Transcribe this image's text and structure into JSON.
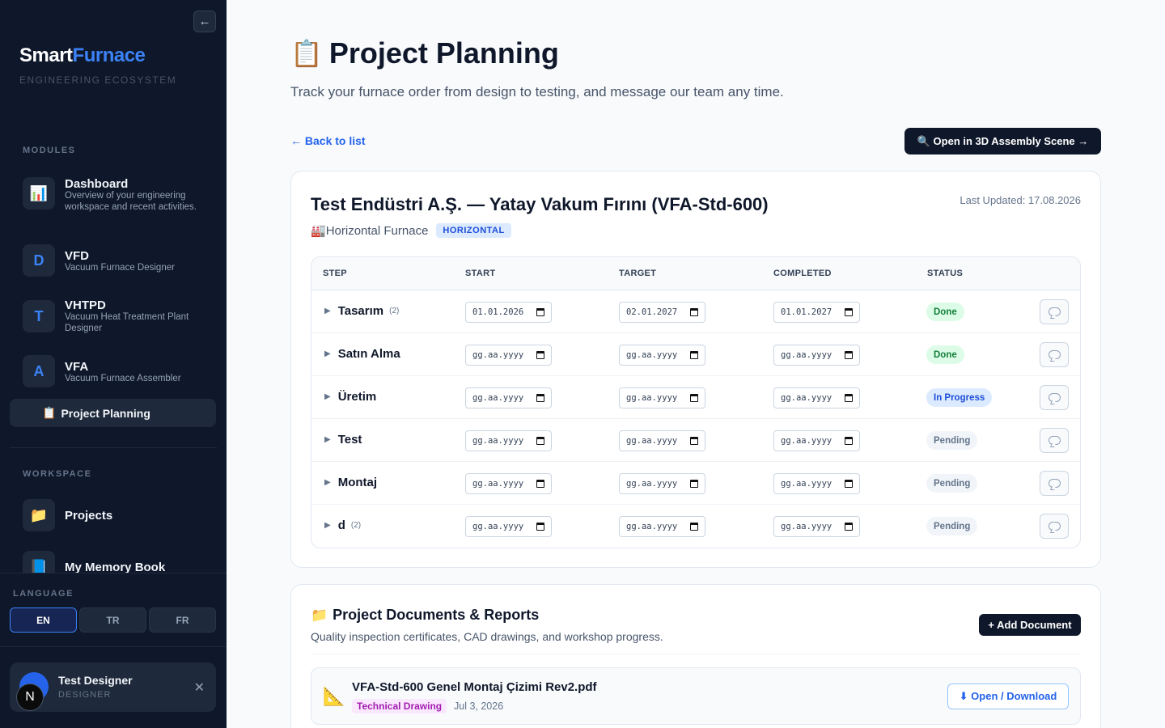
{
  "sidebar": {
    "collapse_icon": "←",
    "brand_part1": "Smart",
    "brand_part2": "Furnace",
    "brand_sub": "ENGINEERING ECOSYSTEM",
    "modules_label": "MODULES",
    "modules": [
      {
        "icon": "📊",
        "title": "Dashboard",
        "desc": "Overview of your engineering workspace and recent activities."
      },
      {
        "icon": "D",
        "title": "VFD",
        "desc": "Vacuum Furnace Designer"
      },
      {
        "icon": "T",
        "title": "VHTPD",
        "desc": "Vacuum Heat Treatment Plant Designer"
      },
      {
        "icon": "A",
        "title": "VFA",
        "desc": "Vacuum Furnace Assembler"
      }
    ],
    "active_item": {
      "icon": "📋",
      "label": "Project Planning"
    },
    "workspace_label": "WORKSPACE",
    "workspace": [
      {
        "icon": "📁",
        "label": "Projects"
      },
      {
        "icon": "📘",
        "label": "My Memory Book"
      }
    ],
    "language_label": "LANGUAGE",
    "languages": [
      "EN",
      "TR",
      "FR"
    ],
    "active_language": "EN",
    "user": {
      "initial": "N",
      "name": "Test Designer",
      "role": "DESIGNER",
      "close": "✕"
    }
  },
  "header": {
    "icon": "📋",
    "title": "Project Planning",
    "subtitle": "Track your furnace order from design to testing, and message our team any time."
  },
  "toolbar": {
    "back_label": "← Back to list",
    "open3d_label": "🔍 Open in 3D Assembly Scene →"
  },
  "project": {
    "title": "Test Endüstri A.Ş. — Yatay Vakum Fırını (VFA-Std-600)",
    "last_updated": "Last Updated: 17.08.2026",
    "type_icon": "🏭",
    "type_label": "Horizontal Furnace",
    "type_badge": "HORIZONTAL"
  },
  "table": {
    "columns": [
      "STEP",
      "START",
      "TARGET",
      "COMPLETED",
      "STATUS"
    ],
    "rows": [
      {
        "step": "Tasarım",
        "count": "(2)",
        "start": "01.01.2026",
        "target": "02.01.2027",
        "completed": "01.01.2027",
        "status": "Done",
        "status_kind": "done"
      },
      {
        "step": "Satın Alma",
        "count": "",
        "start": "gg.aa.yyyy",
        "target": "gg.aa.yyyy",
        "completed": "gg.aa.yyyy",
        "status": "Done",
        "status_kind": "done"
      },
      {
        "step": "Üretim",
        "count": "",
        "start": "gg.aa.yyyy",
        "target": "gg.aa.yyyy",
        "completed": "gg.aa.yyyy",
        "status": "In Progress",
        "status_kind": "prog"
      },
      {
        "step": "Test",
        "count": "",
        "start": "gg.aa.yyyy",
        "target": "gg.aa.yyyy",
        "completed": "gg.aa.yyyy",
        "status": "Pending",
        "status_kind": "pend"
      },
      {
        "step": "Montaj",
        "count": "",
        "start": "gg.aa.yyyy",
        "target": "gg.aa.yyyy",
        "completed": "gg.aa.yyyy",
        "status": "Pending",
        "status_kind": "pend"
      },
      {
        "step": "d",
        "count": "(2)",
        "start": "gg.aa.yyyy",
        "target": "gg.aa.yyyy",
        "completed": "gg.aa.yyyy",
        "status": "Pending",
        "status_kind": "pend"
      }
    ]
  },
  "documents": {
    "icon": "📁",
    "title": "Project Documents & Reports",
    "subtitle": "Quality inspection certificates, CAD drawings, and workshop progress.",
    "add_label": "+ Add Document",
    "items": [
      {
        "icon": "📐",
        "name": "VFA-Std-600 Genel Montaj Çizimi Rev2.pdf",
        "tag": "Technical Drawing",
        "date": "Jul 3, 2026",
        "open_label": "⬇ Open / Download"
      }
    ]
  }
}
